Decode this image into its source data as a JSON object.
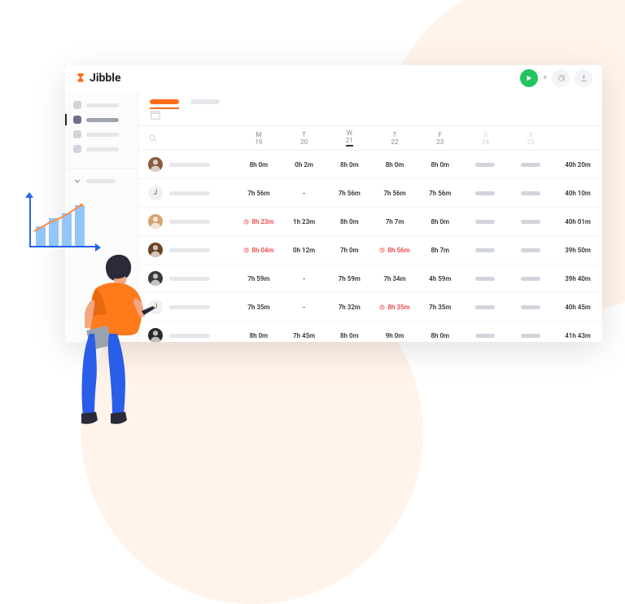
{
  "brand": "Jibble",
  "colors": {
    "accent": "#ff6b1a",
    "success": "#22c55e",
    "warn": "#ef4444"
  },
  "days": [
    {
      "abbr": "M",
      "num": "19",
      "weekend": false,
      "today": false
    },
    {
      "abbr": "T",
      "num": "20",
      "weekend": false,
      "today": false
    },
    {
      "abbr": "W",
      "num": "21",
      "weekend": false,
      "today": true
    },
    {
      "abbr": "T",
      "num": "22",
      "weekend": false,
      "today": false
    },
    {
      "abbr": "F",
      "num": "23",
      "weekend": false,
      "today": false
    },
    {
      "abbr": "S",
      "num": "24",
      "weekend": true,
      "today": false
    },
    {
      "abbr": "S",
      "num": "25",
      "weekend": true,
      "today": false
    }
  ],
  "rows": [
    {
      "avatar": "photo1",
      "cells": [
        {
          "v": "8h 0m"
        },
        {
          "v": "0h 2m"
        },
        {
          "v": "8h 0m"
        },
        {
          "v": "8h 0m"
        },
        {
          "v": "8h 0m"
        },
        {
          "weekend": true
        },
        {
          "weekend": true
        }
      ],
      "total": "40h 20m"
    },
    {
      "avatar": "J",
      "letter": true,
      "cells": [
        {
          "v": "7h 56m"
        },
        {
          "v": "-"
        },
        {
          "v": "7h 56m"
        },
        {
          "v": "7h 56m"
        },
        {
          "v": "7h 56m"
        },
        {
          "weekend": true
        },
        {
          "weekend": true
        }
      ],
      "total": "40h 10m"
    },
    {
      "avatar": "photo2",
      "cells": [
        {
          "v": "8h 23m",
          "warn": true
        },
        {
          "v": "1h 23m"
        },
        {
          "v": "8h 0m"
        },
        {
          "v": "7h 7m"
        },
        {
          "v": "8h 0m"
        },
        {
          "weekend": true
        },
        {
          "weekend": true
        }
      ],
      "total": "40h 01m"
    },
    {
      "avatar": "photo3",
      "cells": [
        {
          "v": "8h 04m",
          "warn": true
        },
        {
          "v": "0h 12m"
        },
        {
          "v": "7h 0m"
        },
        {
          "v": "8h 56m",
          "warn": true
        },
        {
          "v": "8h 7m"
        },
        {
          "weekend": true
        },
        {
          "weekend": true
        }
      ],
      "total": "39h 50m"
    },
    {
      "avatar": "photo4",
      "cells": [
        {
          "v": "7h 59m"
        },
        {
          "v": "-"
        },
        {
          "v": "7h 59m"
        },
        {
          "v": "7h 34m"
        },
        {
          "v": "4h 59m"
        },
        {
          "weekend": true
        },
        {
          "weekend": true
        }
      ],
      "total": "39h 40m"
    },
    {
      "avatar": "J",
      "letter": true,
      "cells": [
        {
          "v": "7h 35m"
        },
        {
          "v": "-"
        },
        {
          "v": "7h 32m"
        },
        {
          "v": "8h 35m",
          "warn": true
        },
        {
          "v": "7h 35m"
        },
        {
          "weekend": true
        },
        {
          "weekend": true
        }
      ],
      "total": "40h 45m"
    },
    {
      "avatar": "photo5",
      "cells": [
        {
          "v": "8h 0m"
        },
        {
          "v": "7h 45m"
        },
        {
          "v": "8h 0m"
        },
        {
          "v": "9h 0m"
        },
        {
          "v": "8h 0m"
        },
        {
          "weekend": true
        },
        {
          "weekend": true
        }
      ],
      "total": "41h 43m"
    }
  ]
}
